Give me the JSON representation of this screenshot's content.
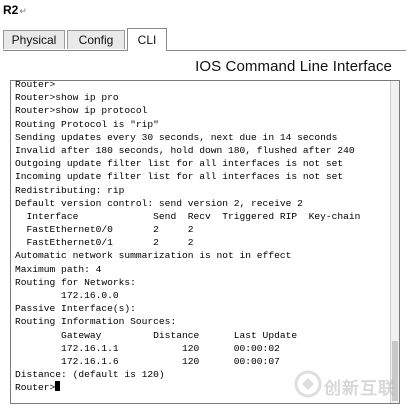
{
  "caption": {
    "label": "R2",
    "return_mark": "↵"
  },
  "tabs": [
    {
      "label": "Physical"
    },
    {
      "label": "Config"
    },
    {
      "label": "CLI",
      "active": true
    }
  ],
  "heading": "IOS Command Line Interface",
  "console": {
    "lines": [
      "Router>",
      "Router>show ip pro",
      "Router>show ip protocol",
      "Routing Protocol is \"rip\"",
      "Sending updates every 30 seconds, next due in 14 seconds",
      "Invalid after 180 seconds, hold down 180, flushed after 240",
      "Outgoing update filter list for all interfaces is not set",
      "Incoming update filter list for all interfaces is not set",
      "Redistributing: rip",
      "Default version control: send version 2, receive 2",
      "  Interface             Send  Recv  Triggered RIP  Key-chain",
      "  FastEthernet0/0       2     2",
      "  FastEthernet0/1       2     2",
      "Automatic network summarization is not in effect",
      "Maximum path: 4",
      "Routing for Networks:",
      "        172.16.0.0",
      "Passive Interface(s):",
      "Routing Information Sources:",
      "        Gateway         Distance      Last Update",
      "        172.16.1.1           120      00:00:02",
      "        172.16.1.6           120      00:00:07",
      "Distance: (default is 120)",
      "Router>"
    ]
  },
  "watermark": {
    "text": "创新互联"
  }
}
